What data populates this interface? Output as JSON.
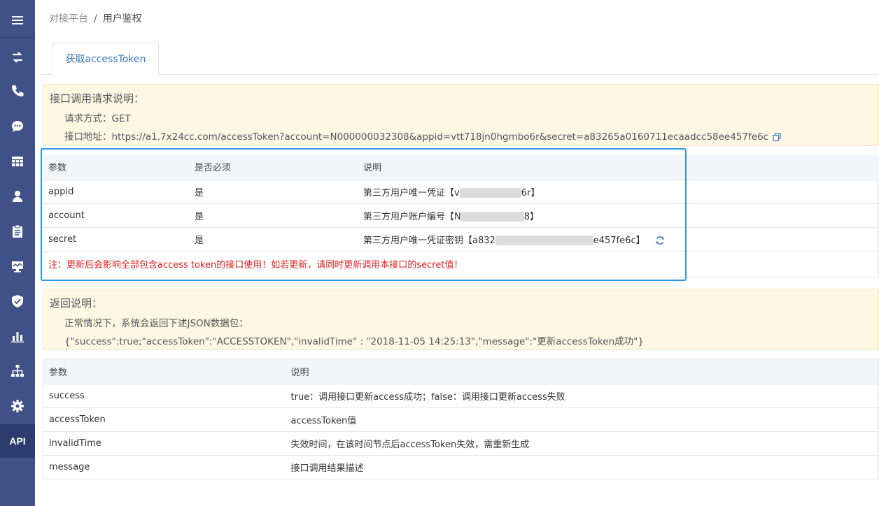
{
  "sidebar": {
    "api_label": "API",
    "icons": [
      "menu-icon",
      "transfer-icon",
      "phone-icon",
      "chat-icon",
      "grid-icon",
      "user-icon",
      "clipboard-icon",
      "monitor-icon",
      "shield-icon",
      "bar-chart-icon",
      "org-chart-icon",
      "gear-icon"
    ]
  },
  "breadcrumb": {
    "root": "对接平台",
    "separator": "/",
    "current": "用户鉴权"
  },
  "tab": {
    "label": "获取accessToken"
  },
  "request_notice": {
    "title": "接口调用请求说明：",
    "method_label": "请求方式：",
    "method": "GET",
    "url_label": "接口地址：",
    "url": "https://a1.7x24cc.com/accessToken?account=N000000032308&appid=vtt718jn0hgmbo6r&secret=a83265a0160711ecaadcc58ee457fe6c"
  },
  "params_table": {
    "headers": [
      "参数",
      "是否必须",
      "说明"
    ],
    "rows": [
      {
        "name": "appid",
        "required": "是",
        "desc_prefix": "第三方用户唯一凭证【v",
        "desc_suffix": "6r】"
      },
      {
        "name": "account",
        "required": "是",
        "desc_prefix": "第三方用户账户编号【N",
        "desc_suffix": "8】"
      },
      {
        "name": "secret",
        "required": "是",
        "desc_prefix": "第三方用户唯一凭证密钥【a832",
        "desc_suffix": "e457fe6c】"
      }
    ],
    "warning": "注：更新后会影响全部包含access token的接口使用！如若更新，请同时更新调用本接口的secret值！"
  },
  "return_notice": {
    "title": "返回说明：",
    "line1": "正常情况下，系统会返回下述JSON数据包：",
    "line2": "{\"success\":true;\"accessToken\":\"ACCESSTOKEN\",\"invalidTime\" : \"2018-11-05 14:25:13\",\"message\":\"更新accessToken成功\"}"
  },
  "return_table": {
    "headers": [
      "参数",
      "说明"
    ],
    "rows": [
      {
        "name": "success",
        "desc": "true：调用接口更新access成功；false：调用接口更新access失败"
      },
      {
        "name": "accessToken",
        "desc": "accessToken值"
      },
      {
        "name": "invalidTime",
        "desc": "失效时间，在该时间节点后accessToken失效，需重新生成"
      },
      {
        "name": "message",
        "desc": "接口调用结果描述"
      }
    ]
  },
  "colors": {
    "sidebar": "#3f5187",
    "accent": "#2b98ee",
    "warning": "#e02020",
    "notice_bg": "#fdf7e4"
  }
}
